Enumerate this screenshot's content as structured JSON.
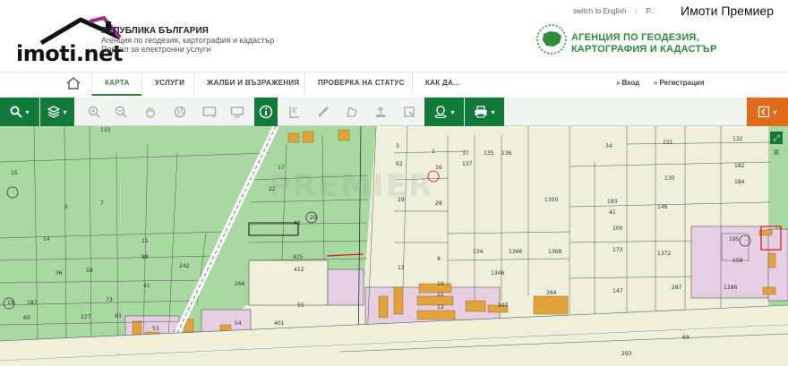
{
  "watermark": {
    "site": "imoti.net",
    "agency": "Имоти Премиер",
    "map_overlay": "PREMIER"
  },
  "header": {
    "title_line1": "РЕПУБЛИКА БЪЛГАРИЯ",
    "title_line2": "Агенция по геодезия, картография и кадастър",
    "title_line3": "Портал за електронни услуги",
    "lang_english": "switch to English",
    "lang_other": "Р...",
    "agency_line1": "АГЕНЦИЯ ПО ГЕОДЕЗИЯ,",
    "agency_line2": "КАРТОГРАФИЯ И КАДАСТЪР"
  },
  "colors": {
    "brand_green": "#127a38",
    "accent_orange": "#e06a17",
    "parcel_green": "#a8d9a0",
    "parcel_light": "#eef0dc",
    "parcel_pink": "#e6cfe3",
    "building": "#e0a43a"
  },
  "nav": {
    "home_icon": "home-icon",
    "items": [
      {
        "label": "КАРТА",
        "active": true
      },
      {
        "label": "УСЛУГИ",
        "active": false
      },
      {
        "label": "ЖАЛБИ И ВЪЗРАЖЕНИЯ",
        "active": false
      },
      {
        "label": "ПРОВЕРКА НА СТАТУС",
        "active": false
      },
      {
        "label": "КАК ДА...",
        "active": false
      }
    ],
    "login": "Вход",
    "register": "Регистрация"
  },
  "toolbar": {
    "icons": [
      "search-icon",
      "layers-icon",
      "zoom-in-icon",
      "zoom-out-icon",
      "pan-hand-icon",
      "globe-icon",
      "fullscreen-icon",
      "screen-icon",
      "info-icon",
      "measure-icon",
      "ruler-icon",
      "area-icon",
      "upload-icon",
      "select-icon",
      "location-icon",
      "print-icon",
      "side-panel-icon"
    ]
  },
  "map": {
    "parcels": [
      "133",
      "15",
      "6",
      "7",
      "14",
      "242",
      "11",
      "98",
      "58",
      "36",
      "41",
      "73",
      "227",
      "63",
      "60",
      "19",
      "187",
      "22",
      "20",
      "17",
      "42",
      "425",
      "412",
      "55",
      "54",
      "401",
      "53",
      "266",
      "62",
      "3",
      "1",
      "16",
      "28",
      "29",
      "13",
      "8",
      "12",
      "22",
      "10",
      "37",
      "135",
      "136",
      "137",
      "134",
      "1366",
      "1368",
      "1346",
      "207",
      "264",
      "1300",
      "34",
      "151",
      "130",
      "132",
      "182",
      "184",
      "183",
      "41",
      "100",
      "146",
      "173",
      "147",
      "1372",
      "287",
      "195",
      "158",
      "1286",
      "293",
      "69",
      "37"
    ]
  }
}
